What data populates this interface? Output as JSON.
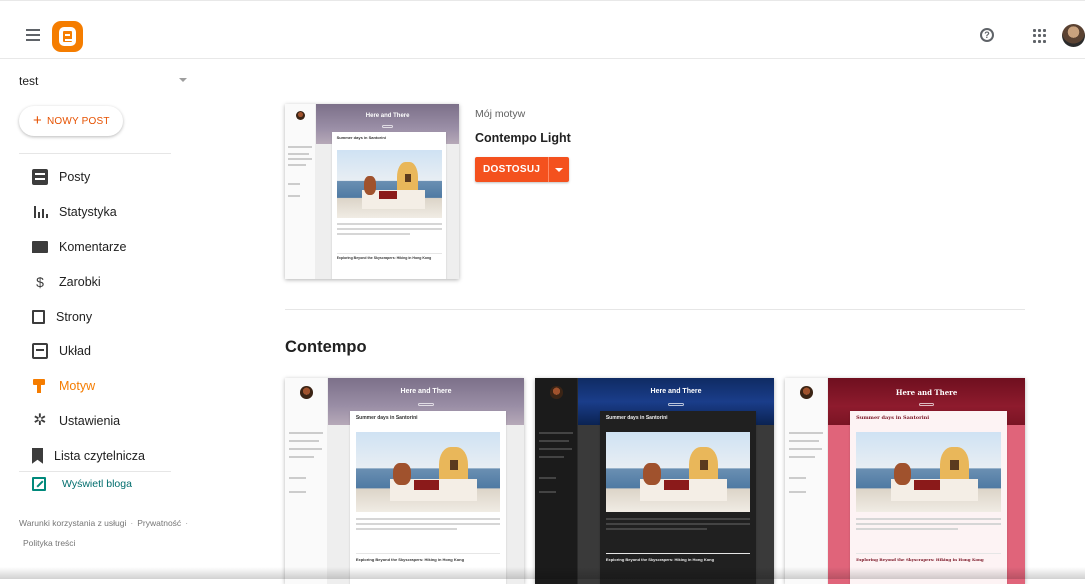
{
  "sidebar": {
    "blog_name": "test",
    "new_post_label": "NOWY POST",
    "items": [
      {
        "label": "Posty",
        "icon": "posts-icon"
      },
      {
        "label": "Statystyka",
        "icon": "stats-icon"
      },
      {
        "label": "Komentarze",
        "icon": "comments-icon"
      },
      {
        "label": "Zarobki",
        "icon": "earnings-icon"
      },
      {
        "label": "Strony",
        "icon": "pages-icon"
      },
      {
        "label": "Układ",
        "icon": "layout-icon"
      },
      {
        "label": "Motyw",
        "icon": "theme-icon",
        "active": true
      },
      {
        "label": "Ustawienia",
        "icon": "settings-icon"
      },
      {
        "label": "Lista czytelnicza",
        "icon": "reading-list-icon"
      }
    ],
    "view_blog_label": "Wyświetl bloga",
    "footer": {
      "terms": "Warunki korzystania z usługi",
      "privacy": "Prywatność",
      "content_policy": "Polityka treści"
    }
  },
  "current_theme": {
    "label": "Mój motyw",
    "name": "Contempo Light",
    "customize_label": "DOSTOSUJ"
  },
  "section": {
    "title": "Contempo"
  },
  "preview": {
    "blog_title": "Here and There",
    "post_title": "Summer days in Santorini",
    "second_post_title": "Exploring Beyond the Skyscrapers: Hiking in Hong Kong"
  },
  "colors": {
    "accent": "#f57c00",
    "button": "#f4511e",
    "link": "#00897b"
  }
}
